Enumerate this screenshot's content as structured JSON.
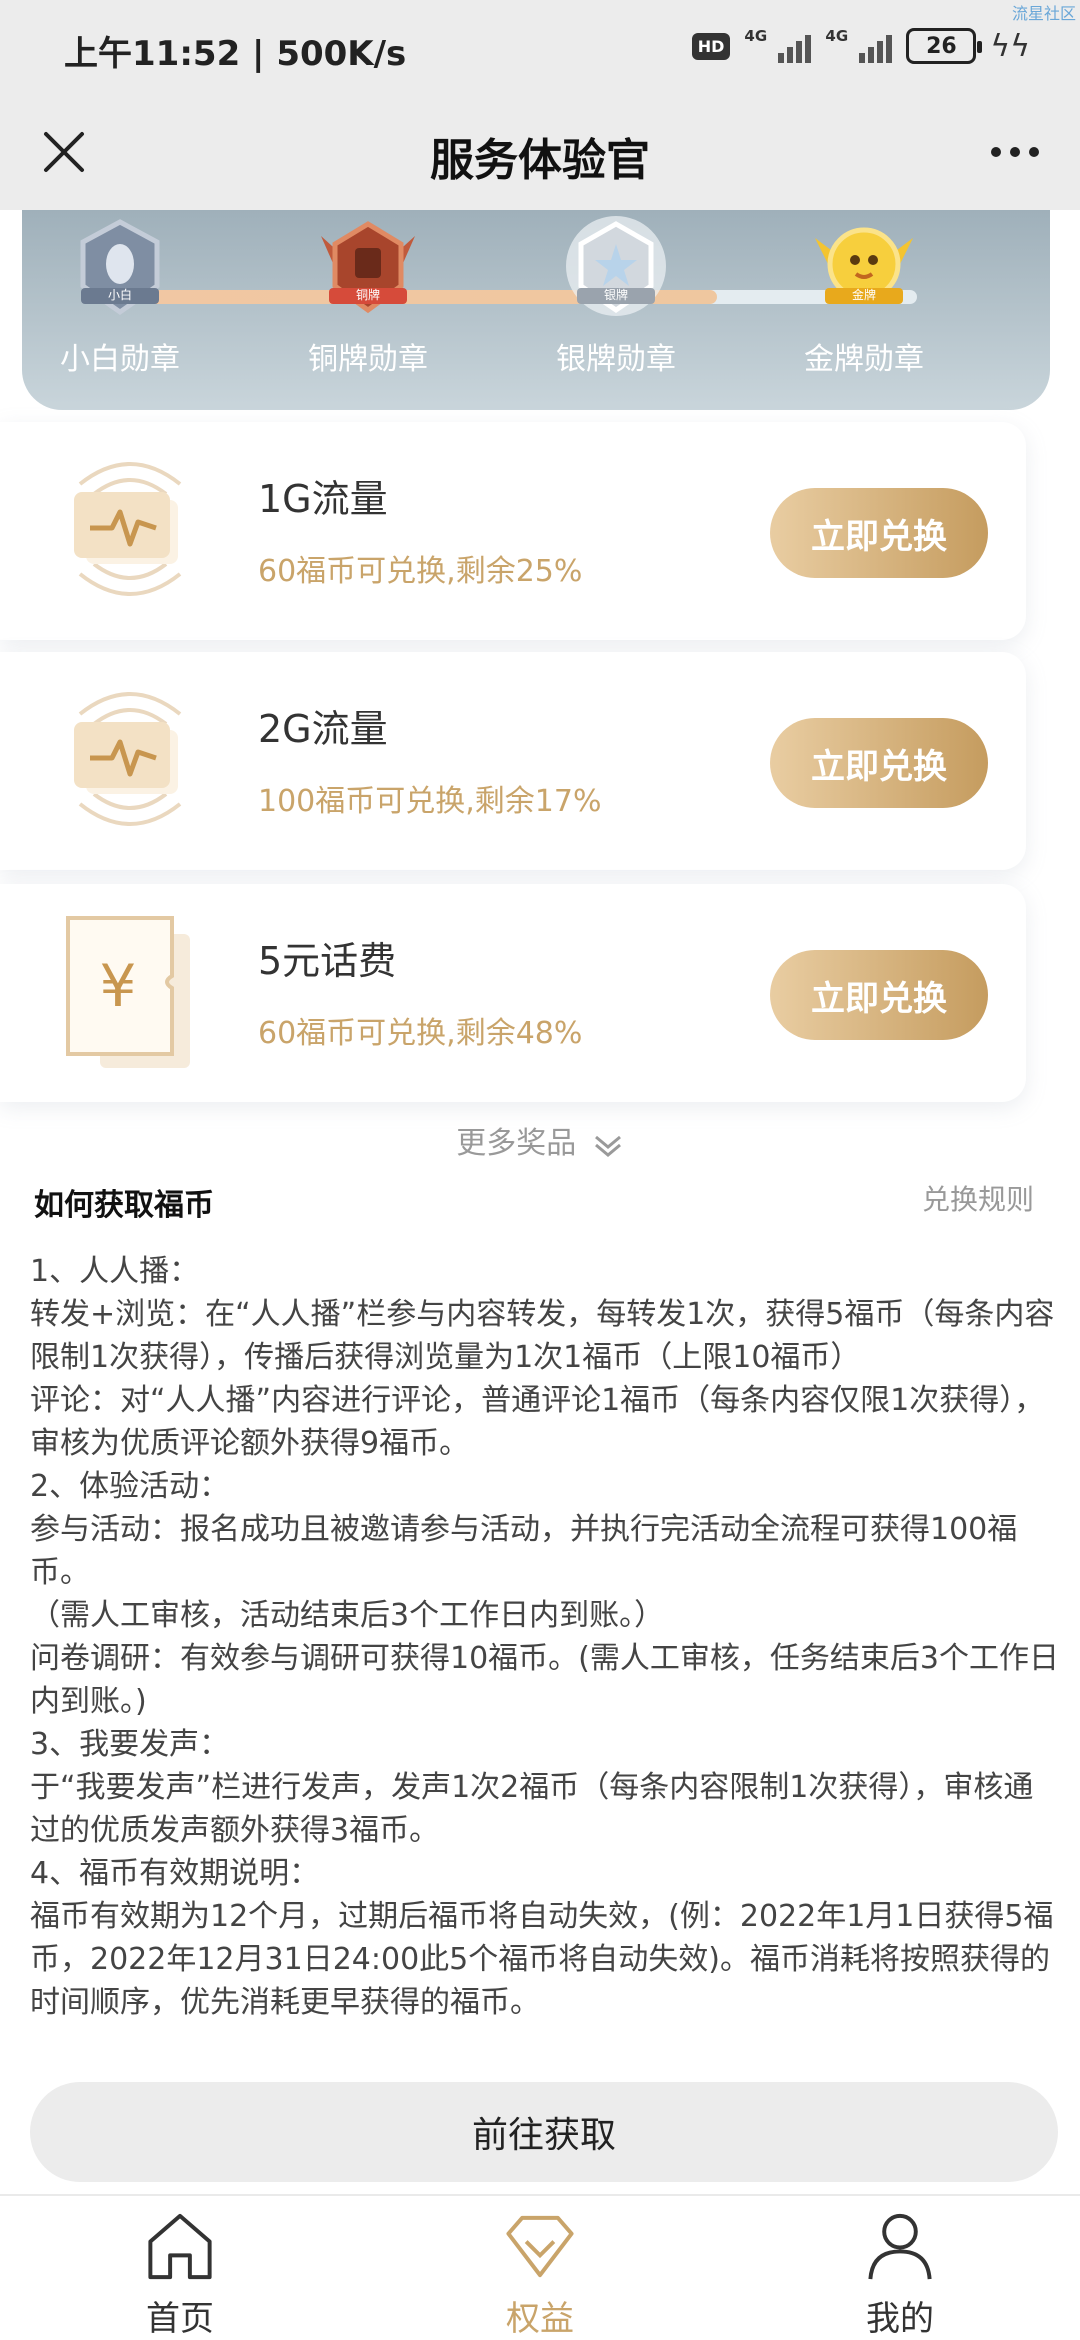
{
  "status_bar": {
    "time": "上午11:52 | 500K/s",
    "hd": "HD",
    "net1": "4G",
    "net2": "4G",
    "battery": "26",
    "corner_tag": "流星社区"
  },
  "nav": {
    "title": "服务体验官"
  },
  "badges": {
    "progress_fraction": 0.74,
    "items": [
      {
        "label": "小白勋章",
        "tag": "小白",
        "color": "#8c98aa"
      },
      {
        "label": "铜牌勋章",
        "tag": "铜牌",
        "color": "#b85a3a"
      },
      {
        "label": "银牌勋章",
        "tag": "银牌",
        "color": "#c9cfd6"
      },
      {
        "label": "金牌勋章",
        "tag": "金牌",
        "color": "#f2c232"
      }
    ]
  },
  "prizes": [
    {
      "name": "1G流量",
      "desc": "60福币可兑换,剩余25%",
      "button": "立即兑换",
      "icon": "data-card-icon"
    },
    {
      "name": "2G流量",
      "desc": "100福币可兑换,剩余17%",
      "button": "立即兑换",
      "icon": "data-card-icon"
    },
    {
      "name": "5元话费",
      "desc": "60福币可兑换,剩余48%",
      "button": "立即兑换",
      "icon": "yuan-ticket-icon"
    }
  ],
  "more_prizes": "更多奖品",
  "rules": {
    "title": "如何获取福币",
    "link": "兑换规则",
    "lines": [
      "1、人人播：",
      "转发+浏览：在“人人播”栏参与内容转发，每转发1次，获得5福币（每条内容限制1次获得），传播后获得浏览量为1次1福币（上限10福币）",
      "评论：对“人人播”内容进行评论，普通评论1福币（每条内容仅限1次获得），审核为优质评论额外获得9福币。",
      "2、体验活动：",
      "参与活动：报名成功且被邀请参与活动，并执行完活动全流程可获得100福币。",
      "（需人工审核，活动结束后3个工作日内到账。）",
      "问卷调研：有效参与调研可获得10福币。(需人工审核，任务结束后3个工作日内到账。)",
      "3、我要发声：",
      "于“我要发声”栏进行发声，发声1次2福币（每条内容限制1次获得），审核通过的优质发声额外获得3福币。",
      "4、福币有效期说明：",
      "福币有效期为12个月，过期后福币将自动失效，(例：2022年1月1日获得5福币，2022年12月31日24:00此5个福币将自动失效)。福币消耗将按照获得的时间顺序，优先消耗更早获得的福币。"
    ]
  },
  "go_button": "前往获取",
  "tabs": [
    {
      "label": "首页",
      "icon": "home-icon",
      "active": false
    },
    {
      "label": "权益",
      "icon": "diamond-icon",
      "active": true
    },
    {
      "label": "我的",
      "icon": "user-icon",
      "active": false
    }
  ],
  "colors": {
    "accent_gold": "#c9a46a",
    "button_gradient_start": "#e9cda2",
    "button_gradient_end": "#c59c5f"
  }
}
